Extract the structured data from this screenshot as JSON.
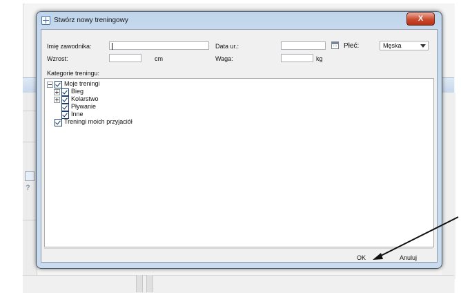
{
  "dialog": {
    "title": "Stwórz nowy treningowy",
    "close_label": "X"
  },
  "form": {
    "name_label": "Imię zawodnika:",
    "name_value": "",
    "dob_label": "Data ur.:",
    "dob_value": "",
    "sex_label": "Płeć:",
    "sex_value": "Męska",
    "height_label": "Wzrost:",
    "height_value": "",
    "height_unit": "cm",
    "weight_label": "Waga:",
    "weight_value": "",
    "weight_unit": "kg",
    "categories_label": "Kategorie treningu:"
  },
  "tree": [
    {
      "label": "Moje treningi",
      "checked": true,
      "expander": "minus"
    },
    {
      "label": "Bieg",
      "checked": true,
      "expander": "plus"
    },
    {
      "label": "Kolarstwo",
      "checked": true,
      "expander": "plus"
    },
    {
      "label": "Pływanie",
      "checked": true,
      "expander": "none"
    },
    {
      "label": "Inne",
      "checked": true,
      "expander": "none"
    },
    {
      "label": "Treningi moich przyjaciół",
      "checked": true,
      "expander": "none"
    }
  ],
  "buttons": {
    "ok": "OK",
    "cancel": "Anuluj"
  },
  "colors": {
    "frame": "#c6d9ee",
    "close": "#c9492d"
  }
}
